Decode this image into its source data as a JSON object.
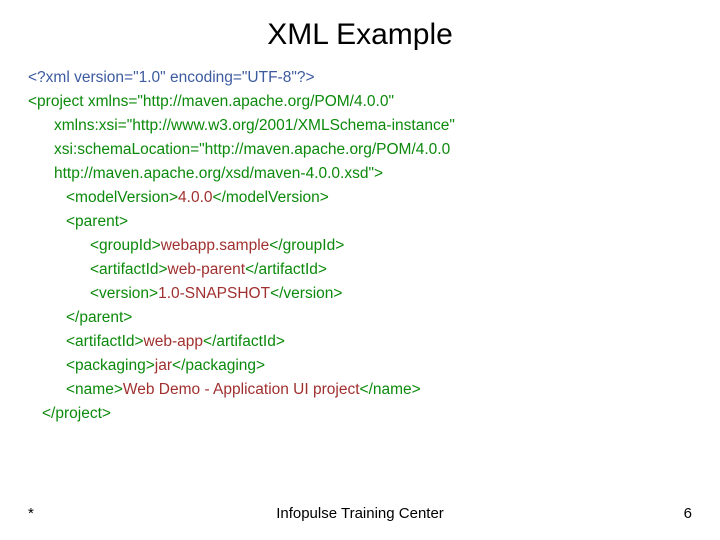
{
  "title": "XML Example",
  "lines": {
    "l0": "<?xml version=\"1.0\" encoding=\"UTF-8\"?>",
    "l1": "<project xmlns=\"http://maven.apache.org/POM/4.0.0\"",
    "l2": "xmlns:xsi=\"http://www.w3.org/2001/XMLSchema-instance\"",
    "l3": "xsi:schemaLocation=\"http://maven.apache.org/POM/4.0.0",
    "l4": "http://maven.apache.org/xsd/maven-4.0.0.xsd\">",
    "l5a": "<modelVersion>",
    "l5b": "4.0.0",
    "l5c": "</modelVersion>",
    "l6": "<parent>",
    "l7a": "<groupId>",
    "l7b": "webapp.sample",
    "l7c": "</groupId>",
    "l8a": "<artifactId>",
    "l8b": "web-parent",
    "l8c": "</artifactId>",
    "l9a": "<version>",
    "l9b": "1.0-SNAPSHOT",
    "l9c": "</version>",
    "l10": "</parent>",
    "l11a": "<artifactId>",
    "l11b": "web-app",
    "l11c": "</artifactId>",
    "l12a": "<packaging>",
    "l12b": "jar",
    "l12c": "</packaging>",
    "l13a": "<name>",
    "l13b": "Web Demo - Application UI project",
    "l13c": "</name>",
    "l14": "</project>"
  },
  "footer": {
    "left": "*",
    "center": "Infopulse Training Center",
    "right": "6"
  }
}
